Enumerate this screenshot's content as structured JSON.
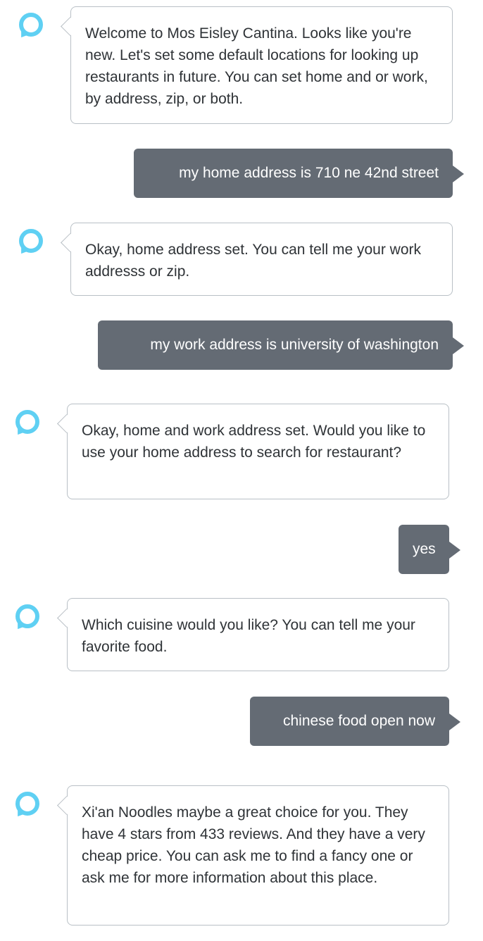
{
  "conversation": {
    "messages": [
      {
        "speaker": "assistant",
        "text": "Welcome to Mos Eisley Cantina. Looks like you're new. Let's set some default locations for looking up restaurants in future. You can set home and or work, by address, zip, or both."
      },
      {
        "speaker": "user",
        "text": "my home address is 710 ne 42nd street"
      },
      {
        "speaker": "assistant",
        "text": "Okay, home address set. You can tell me your work addresss or zip."
      },
      {
        "speaker": "user",
        "text": "my work address is university of washington"
      },
      {
        "speaker": "assistant",
        "text": "Okay, home and work address set. Would you like to use your home address to search for restaurant?"
      },
      {
        "speaker": "user",
        "text": "yes"
      },
      {
        "speaker": "assistant",
        "text": "Which cuisine would you like? You can tell me your favorite food."
      },
      {
        "speaker": "user",
        "text": "chinese food open now"
      },
      {
        "speaker": "assistant",
        "text": "Xi'an Noodles maybe a great choice for you. They have 4 stars from 433 reviews. And they have a very cheap price. You can ask me to find a fancy one or ask me for more information about this place."
      }
    ]
  },
  "colors": {
    "assistant_icon": "#5fd0f3",
    "user_bubble": "#646b74",
    "assistant_border": "#b9c0c6",
    "assistant_text": "#2f3337",
    "user_text": "#ffffff"
  },
  "icons": {
    "assistant": "alexa-ring-icon"
  }
}
